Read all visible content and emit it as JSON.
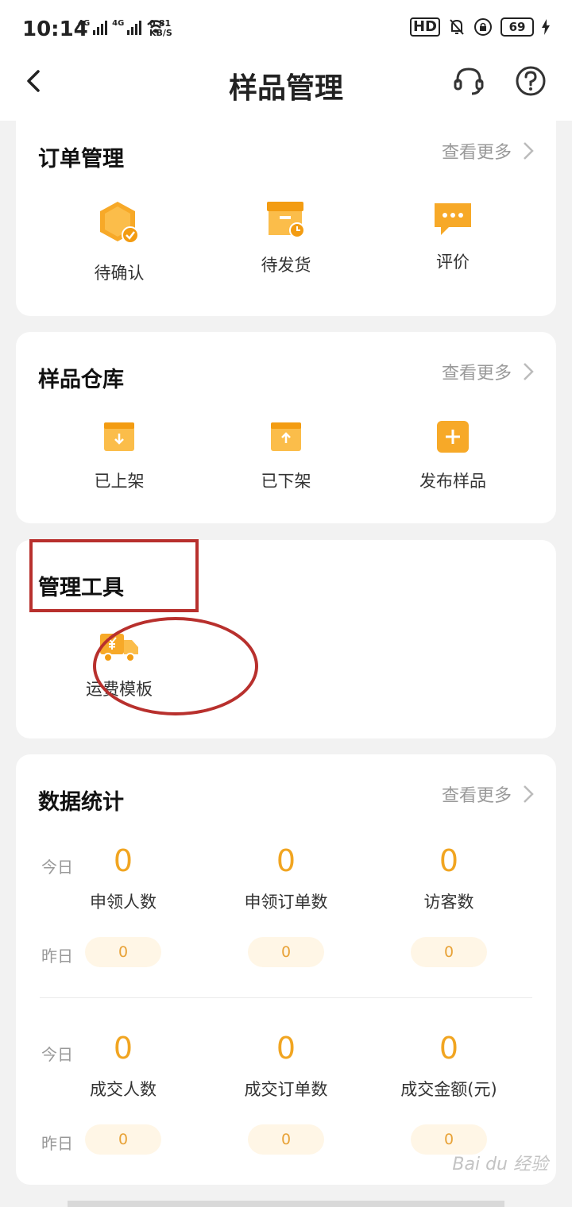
{
  "status": {
    "time": "10:14",
    "net1": "4G",
    "net2": "4G",
    "speed_value": "0.81",
    "speed_unit": "KB/S",
    "hd": "HD",
    "battery": "69"
  },
  "nav": {
    "title": "样品管理"
  },
  "orders": {
    "title": "订单管理",
    "more": "查看更多",
    "items": [
      {
        "label": "待确认",
        "icon": "hexagon-check-icon"
      },
      {
        "label": "待发货",
        "icon": "box-clock-icon"
      },
      {
        "label": "评价",
        "icon": "chat-bubble-icon"
      }
    ]
  },
  "warehouse": {
    "title": "样品仓库",
    "more": "查看更多",
    "items": [
      {
        "label": "已上架",
        "icon": "box-down-icon"
      },
      {
        "label": "已下架",
        "icon": "box-up-icon"
      },
      {
        "label": "发布样品",
        "icon": "plus-square-icon"
      }
    ]
  },
  "tools": {
    "title": "管理工具",
    "items": [
      {
        "label": "运费模板",
        "icon": "truck-yen-icon"
      }
    ]
  },
  "stats": {
    "title": "数据统计",
    "more": "查看更多",
    "today": "今日",
    "yesterday": "昨日",
    "row1": [
      {
        "name": "申领人数",
        "today": "0",
        "yesterday": "0"
      },
      {
        "name": "申领订单数",
        "today": "0",
        "yesterday": "0"
      },
      {
        "name": "访客数",
        "today": "0",
        "yesterday": "0"
      }
    ],
    "row2": [
      {
        "name": "成交人数",
        "today": "0",
        "yesterday": "0"
      },
      {
        "name": "成交订单数",
        "today": "0",
        "yesterday": "0"
      },
      {
        "name": "成交金额(元)",
        "today": "0",
        "yesterday": "0"
      }
    ]
  },
  "colors": {
    "accent": "#f1a521",
    "annotation": "#b8302d",
    "pill_bg": "#fff6e6"
  },
  "watermark": "Bai du 经验"
}
